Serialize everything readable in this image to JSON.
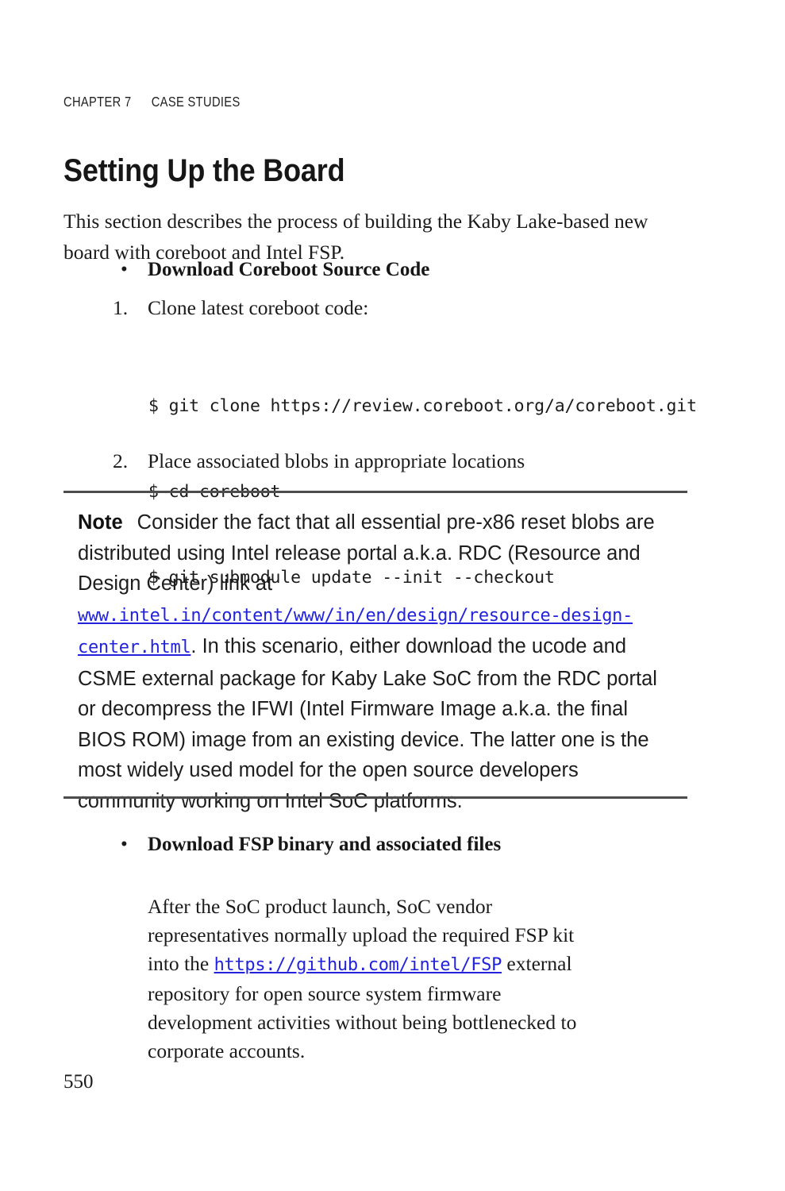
{
  "document": {
    "running_head": {
      "chapter": "CHAPTER 7",
      "section": "CASE STUDIES"
    },
    "page_title": "Setting Up the Board",
    "intro_paragraph": "This section describes the process of building the Kaby Lake-based new board with coreboot and Intel FSP.",
    "bullets": [
      {
        "marker": "•",
        "label": "Download Coreboot Source Code"
      },
      {
        "marker": "•",
        "label": "Download FSP binary and associated files"
      }
    ],
    "numbered_items": [
      {
        "marker": "1.",
        "text": "Clone latest coreboot code:"
      },
      {
        "marker": "2.",
        "text": "Place associated blobs in appropriate locations"
      }
    ],
    "code_block": {
      "lines": [
        "$ git clone https://review.coreboot.org/a/coreboot.git",
        "$ cd coreboot",
        "$ git submodule update --init --checkout"
      ]
    },
    "note": {
      "label": "Note",
      "text_before_link": "Consider the fact that all essential pre-x86 reset blobs are distributed using Intel release portal a.k.a. RDC (Resource and Design Center) link at ",
      "link": "www.intel.in/content/www/in/en/design/resource-design-center.html",
      "text_after_link": ". In this scenario, either download the ucode and CSME external package for Kaby Lake SoC from the RDC portal or decompress the IFWI (Intel Firmware Image a.k.a. the final BIOS ROM) image from an existing device. The latter one is the most widely used model for the open source developers community working on Intel SoC platforms."
    },
    "fsp_paragraph": {
      "text_before_link": "After the SoC product launch, SoC vendor representatives normally upload the required FSP kit into the ",
      "link": "https://github.com/intel/FSP",
      "text_after_link": " external repository for open source system firmware development activities without being bottlenecked to corporate accounts."
    },
    "folio": "550",
    "colors": {
      "text": "#1b1b1b",
      "link": "#2222dd",
      "rule": "#4d4d4d",
      "background": "#ffffff"
    }
  }
}
